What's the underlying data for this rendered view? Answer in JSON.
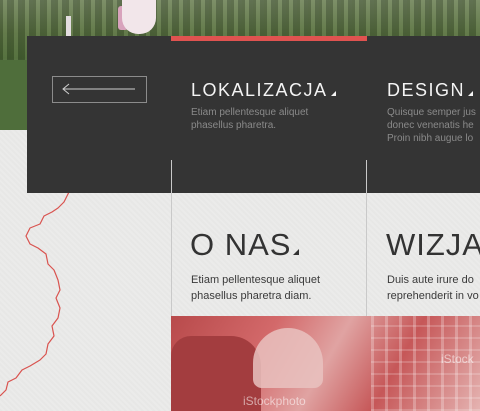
{
  "nav": {
    "back_label": "",
    "items": [
      {
        "title": "LOKALIZACJA",
        "desc_lines": [
          "Etiam pellentesque aliquet",
          "phasellus pharetra."
        ]
      },
      {
        "title": "DESIGN",
        "desc_lines": [
          "Quisque semper jus",
          "donec venenatis he",
          "Proin nibh augue lo"
        ]
      }
    ]
  },
  "sections": [
    {
      "title": "O NAS",
      "desc_lines": [
        "Etiam pellentesque aliquet",
        "phasellus pharetra diam."
      ]
    },
    {
      "title": "WIZJA",
      "desc_lines": [
        "Duis aute irure do",
        "reprehenderit in vo"
      ]
    }
  ],
  "photo": {
    "watermark": "iStockphoto",
    "watermark_right": "iStock"
  },
  "colors": {
    "accent": "#e05350",
    "panel": "#343434",
    "paper": "#ebebea"
  },
  "icons": {
    "back": "arrow-left-icon",
    "caret": "triangle-corner-icon"
  }
}
